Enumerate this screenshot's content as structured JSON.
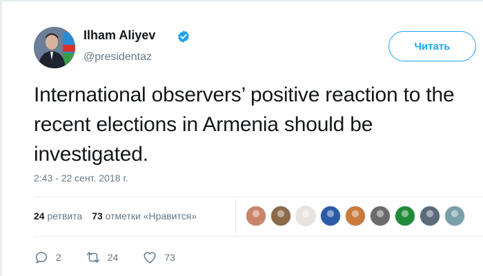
{
  "author": {
    "name": "Ilham Aliyev",
    "handle": "@presidentaz",
    "verified": true
  },
  "follow_button": {
    "label": "Читать"
  },
  "tweet": {
    "text": "International observers’ positive reaction to the recent elections in Armenia should be investigated.",
    "timestamp": "2:43 - 22 сент. 2018 г."
  },
  "stats": {
    "retweets_count": "24",
    "retweets_label": "ретвита",
    "likes_count": "73",
    "likes_label": "отметки «Нравится»"
  },
  "likers": [
    {
      "name": "liker-1",
      "color": "#c9846a"
    },
    {
      "name": "liker-2",
      "color": "#8a6a48"
    },
    {
      "name": "liker-3",
      "color": "#e8e3de"
    },
    {
      "name": "liker-4",
      "color": "#2a5aa8"
    },
    {
      "name": "liker-5",
      "color": "#c97a3a"
    },
    {
      "name": "liker-6",
      "color": "#6b6b6b"
    },
    {
      "name": "liker-7",
      "color": "#1f8a3a"
    },
    {
      "name": "liker-8",
      "color": "#5a6a7a"
    },
    {
      "name": "liker-9",
      "color": "#7aa0a8"
    }
  ],
  "actions": {
    "reply_count": "2",
    "retweet_count": "24",
    "like_count": "73"
  },
  "colors": {
    "accent": "#1da1f2",
    "text_primary": "#14171a",
    "text_secondary": "#657786",
    "divider": "#e6ecf0"
  }
}
